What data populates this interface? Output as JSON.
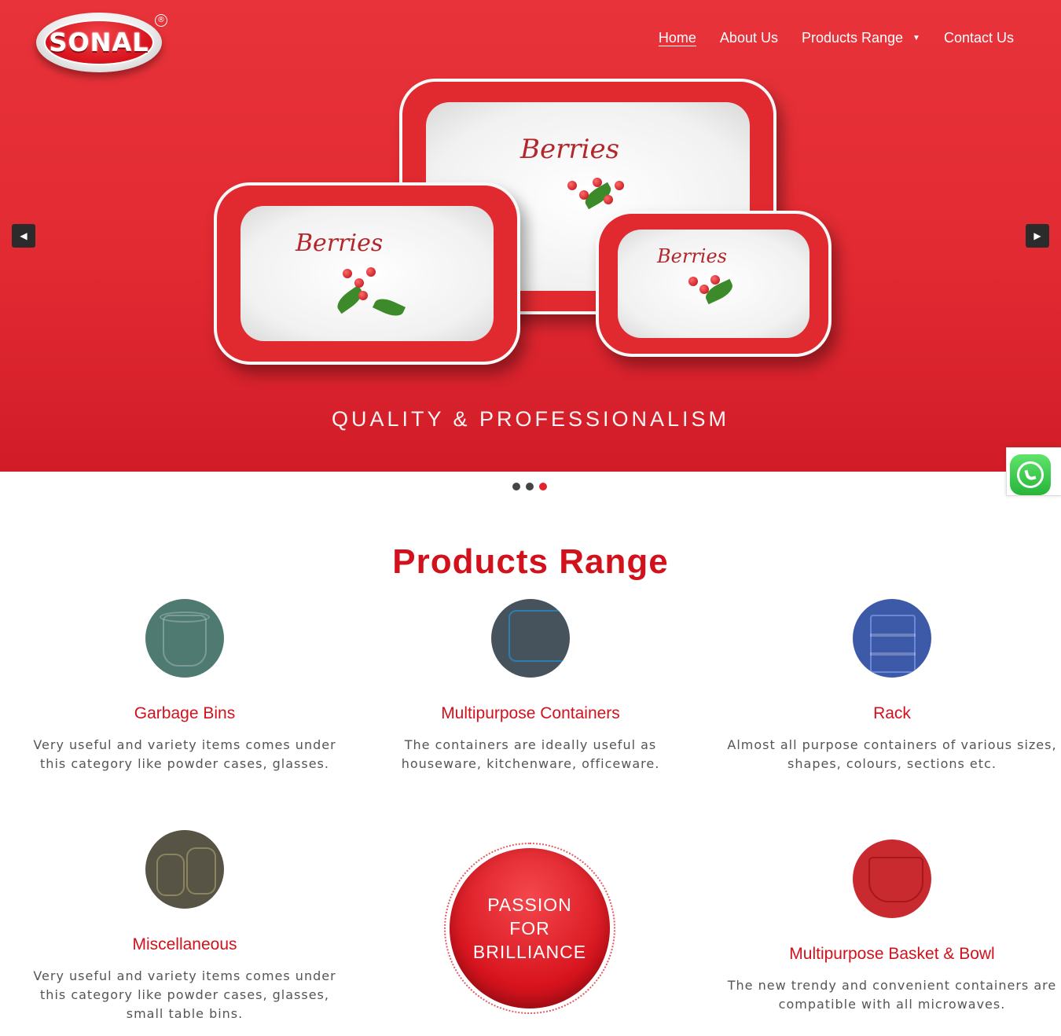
{
  "brand": {
    "logo_text": "SONAL",
    "reg_mark": "®"
  },
  "nav": {
    "items": [
      {
        "label": "Home",
        "active": true
      },
      {
        "label": "About Us",
        "active": false
      },
      {
        "label": "Products Range",
        "active": false,
        "has_dropdown": true
      },
      {
        "label": "Contact Us",
        "active": false
      }
    ]
  },
  "hero": {
    "tagline": "QUALITY & PROFESSIONALISM",
    "tray_print": "Berries",
    "slides_count": 3,
    "active_slide": 3,
    "prev_icon": "caret-left-icon",
    "next_icon": "caret-right-icon"
  },
  "whatsapp": {
    "icon": "whatsapp-icon"
  },
  "products": {
    "title": "Products Range",
    "items": [
      {
        "name": "Garbage Bins",
        "desc": "Very useful and variety items comes under this category like powder cases, glasses.",
        "icon": "garbage-bin-icon",
        "color": "#4f7a72"
      },
      {
        "name": "Multipurpose Containers",
        "desc": "The containers are ideally useful as houseware, kitchenware, officeware.",
        "icon": "container-icon",
        "color": "#46535d"
      },
      {
        "name": "Rack",
        "desc": "Almost all purpose containers of various sizes, shapes, colours, sections etc.",
        "icon": "rack-icon",
        "color": "#3d5aa8"
      },
      {
        "name": "Miscellaneous",
        "desc": "Very useful and variety items comes under this category like powder cases, glasses, small table bins.",
        "icon": "misc-jars-icon",
        "color": "#575445"
      },
      {
        "name": "Multipurpose Basket & Bowl",
        "desc": "The new trendy and convenient containers are compatible with all microwaves.",
        "icon": "basket-icon",
        "color": "#c92a30"
      }
    ],
    "badge": {
      "lines": [
        "PASSION",
        "FOR",
        "BRILLIANCE"
      ]
    }
  },
  "colors": {
    "brand_red": "#d1121c",
    "hero_red": "#e22a32",
    "dot_active": "#e2252b"
  }
}
